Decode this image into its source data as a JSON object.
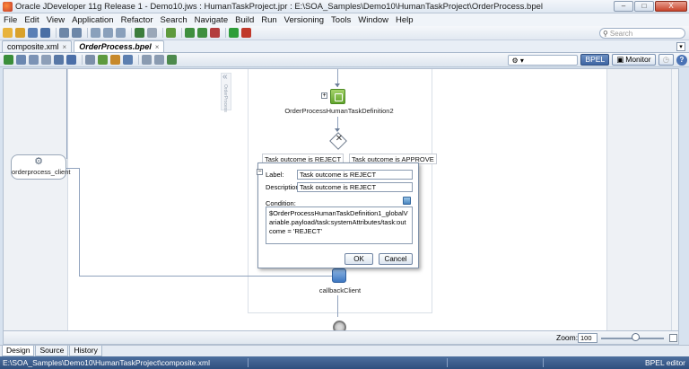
{
  "window": {
    "title": "Oracle JDeveloper 11g Release 1 - Demo10.jws : HumanTaskProject.jpr : E:\\SOA_Samples\\Demo10\\HumanTaskProject\\OrderProcess.bpel",
    "minimize": "–",
    "maximize": "□",
    "close": "X"
  },
  "menu": {
    "items": [
      "File",
      "Edit",
      "View",
      "Application",
      "Refactor",
      "Search",
      "Navigate",
      "Build",
      "Run",
      "Versioning",
      "Tools",
      "Window",
      "Help"
    ]
  },
  "toolbar": {
    "search_placeholder": "Search"
  },
  "tabs": [
    {
      "label": "composite.xml"
    },
    {
      "label": "OrderProcess.bpel"
    }
  ],
  "bpel_toolbar": {
    "bpel_label": "BPEL",
    "monitor_label": "Monitor",
    "help_label": "?"
  },
  "canvas": {
    "partner_link": "orderprocess_client",
    "collapse_text": "OrderProcess",
    "task_label": "OrderProcessHumanTaskDefinition2",
    "case_reject": "Task outcome is REJECT",
    "case_approve": "Task outcome is APPROVE",
    "callback_label": "callbackClient"
  },
  "dialog": {
    "label_caption": "Label:",
    "label_value": "Task outcome is REJECT",
    "description_caption": "Description:",
    "description_value": "Task outcome is REJECT",
    "condition_caption": "Condition:",
    "condition_value": "$OrderProcessHumanTaskDefinition1_globalVariable.payload/task:systemAttributes/task:outcome = 'REJECT'",
    "ok_label": "OK",
    "cancel_label": "Cancel"
  },
  "zoom": {
    "label": "Zoom:",
    "value": "100",
    "level": 0.55
  },
  "bottom_tabs": [
    "Design",
    "Source",
    "History"
  ],
  "status": {
    "path": "E:\\SOA_Samples\\Demo10\\HumanTaskProject\\composite.xml",
    "editor": "BPEL editor"
  }
}
